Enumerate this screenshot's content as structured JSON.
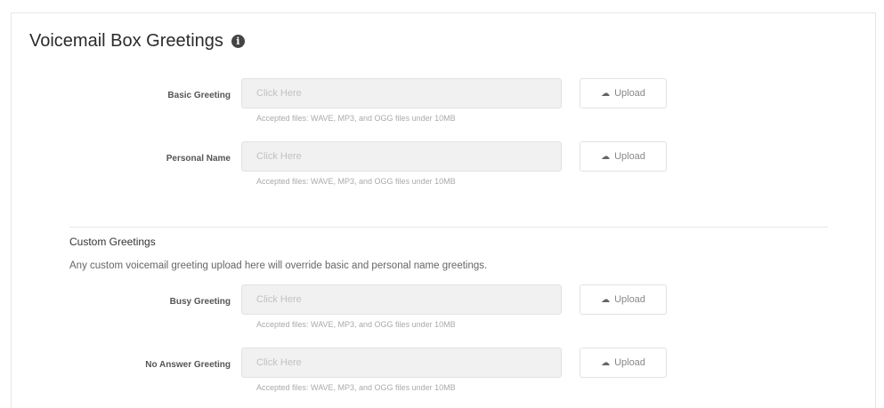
{
  "section": {
    "title": "Voicemail Box Greetings",
    "info_icon": "i"
  },
  "upload_label": "Upload",
  "greetings": [
    {
      "label": "Basic Greeting",
      "placeholder": "Click Here",
      "help": "Accepted files: WAVE, MP3, and OGG files under 10MB"
    },
    {
      "label": "Personal Name",
      "placeholder": "Click Here",
      "help": "Accepted files: WAVE, MP3, and OGG files under 10MB"
    }
  ],
  "custom": {
    "title": "Custom Greetings",
    "description": "Any custom voicemail greeting upload here will override basic and personal name greetings.",
    "greetings": [
      {
        "label": "Busy Greeting",
        "placeholder": "Click Here",
        "help": "Accepted files: WAVE, MP3, and OGG files under 10MB"
      },
      {
        "label": "No Answer Greeting",
        "placeholder": "Click Here",
        "help": "Accepted files: WAVE, MP3, and OGG files under 10MB"
      }
    ]
  },
  "icons": {
    "upload": "cloud-upload-icon",
    "info": "info-circle-icon"
  }
}
